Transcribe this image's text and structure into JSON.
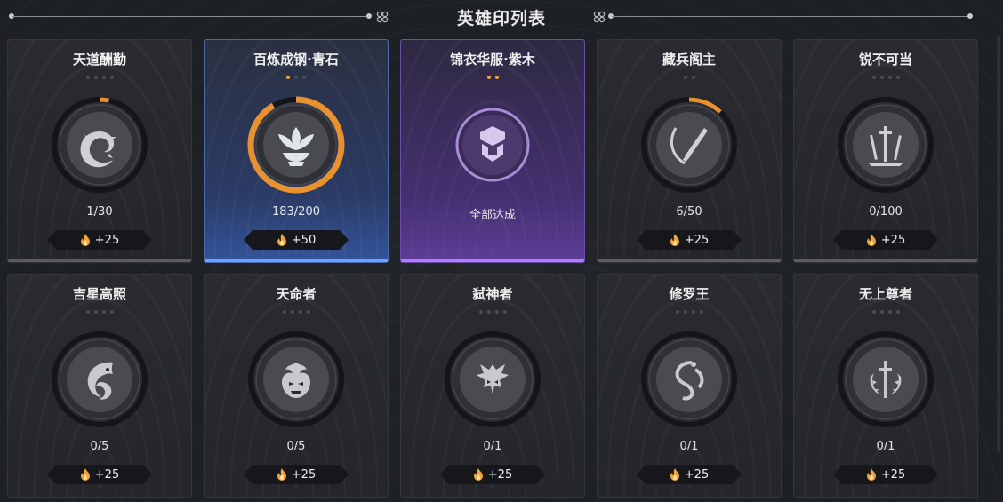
{
  "header": {
    "title": "英雄印列表"
  },
  "colors": {
    "orange_ring": "#e8922f",
    "blue_glow": "#6aa4ff",
    "purple_glow": "#b47aff",
    "star_on": "#e8a33a"
  },
  "cards": [
    {
      "name": "天道酬勤",
      "stars_total": 4,
      "stars_on": 0,
      "progress_text": "1/30",
      "progress": 0.033,
      "reward": "+25",
      "icon": "swirl-icon",
      "theme": "grey"
    },
    {
      "name": "百炼成钢·青石",
      "stars_total": 3,
      "stars_on": 1,
      "progress_text": "183/200",
      "progress": 0.915,
      "reward": "+50",
      "icon": "lotus-icon",
      "theme": "blue"
    },
    {
      "name": "锦衣华服·紫木",
      "stars_total": 2,
      "stars_on": 2,
      "progress_text": "全部达成",
      "progress": 1,
      "reward": "",
      "icon": "armor-icon",
      "theme": "purple"
    },
    {
      "name": "藏兵阁主",
      "stars_total": 2,
      "stars_on": 0,
      "progress_text": "6/50",
      "progress": 0.12,
      "reward": "+25",
      "icon": "blade-icon",
      "theme": "grey"
    },
    {
      "name": "锐不可当",
      "stars_total": 4,
      "stars_on": 0,
      "progress_text": "0/100",
      "progress": 0,
      "reward": "+25",
      "icon": "swords-icon",
      "theme": "grey"
    },
    {
      "name": "吉星高照",
      "stars_total": 4,
      "stars_on": 0,
      "progress_text": "0/5",
      "progress": 0,
      "reward": "+25",
      "icon": "koi-icon",
      "theme": "grey"
    },
    {
      "name": "天命者",
      "stars_total": 4,
      "stars_on": 0,
      "progress_text": "0/5",
      "progress": 0,
      "reward": "+25",
      "icon": "demon-mask-icon",
      "theme": "grey"
    },
    {
      "name": "弑神者",
      "stars_total": 4,
      "stars_on": 0,
      "progress_text": "0/1",
      "progress": 0,
      "reward": "+25",
      "icon": "dragon-head-icon",
      "theme": "grey"
    },
    {
      "name": "修罗王",
      "stars_total": 4,
      "stars_on": 0,
      "progress_text": "0/1",
      "progress": 0,
      "reward": "+25",
      "icon": "coiled-dragon-icon",
      "theme": "grey"
    },
    {
      "name": "无上尊者",
      "stars_total": 4,
      "stars_on": 0,
      "progress_text": "0/1",
      "progress": 0,
      "reward": "+25",
      "icon": "laurel-sword-icon",
      "theme": "grey"
    }
  ]
}
